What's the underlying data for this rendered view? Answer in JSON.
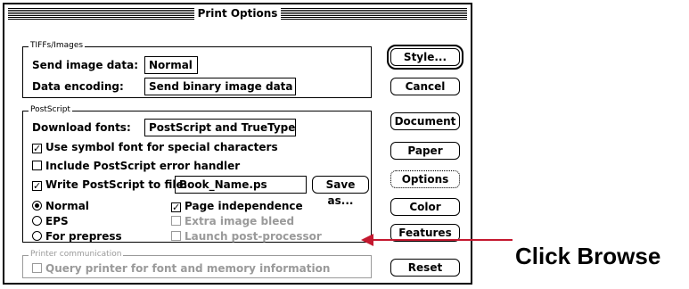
{
  "window": {
    "title": "Print Options"
  },
  "tiffs_group": {
    "label": "TIFFs/Images",
    "send_label": "Send image data:",
    "send_value": "Normal",
    "encoding_label": "Data encoding:",
    "encoding_value": "Send binary image data"
  },
  "postscript_group": {
    "label": "PostScript",
    "download_label": "Download fonts:",
    "download_value": "PostScript and TrueType",
    "symbol_font": {
      "label": "Use symbol font for special characters",
      "checked": true
    },
    "error_handler": {
      "label": "Include PostScript error handler",
      "checked": false
    },
    "write_ps": {
      "label": "Write PostScript to file:",
      "checked": true
    },
    "file_name": "Book_Name.ps",
    "save_as": "Save as...",
    "radios": {
      "normal": "Normal",
      "eps": "EPS",
      "prepress": "For prepress",
      "selected": "Normal"
    },
    "page_independence": {
      "label": "Page independence",
      "checked": true
    },
    "extra_bleed": {
      "label": "Extra image bleed",
      "checked": false
    },
    "post_processor": {
      "label": "Launch post-processor",
      "checked": false
    }
  },
  "printer_group": {
    "label": "Printer communication",
    "query": {
      "label": "Query printer for font and memory information",
      "checked": false
    }
  },
  "buttons": {
    "style": "Style...",
    "cancel": "Cancel",
    "document": "Document",
    "paper": "Paper",
    "options": "Options",
    "color": "Color",
    "features": "Features",
    "reset": "Reset"
  },
  "annotation": {
    "text": "Click Browse",
    "color": "#c4182f"
  }
}
